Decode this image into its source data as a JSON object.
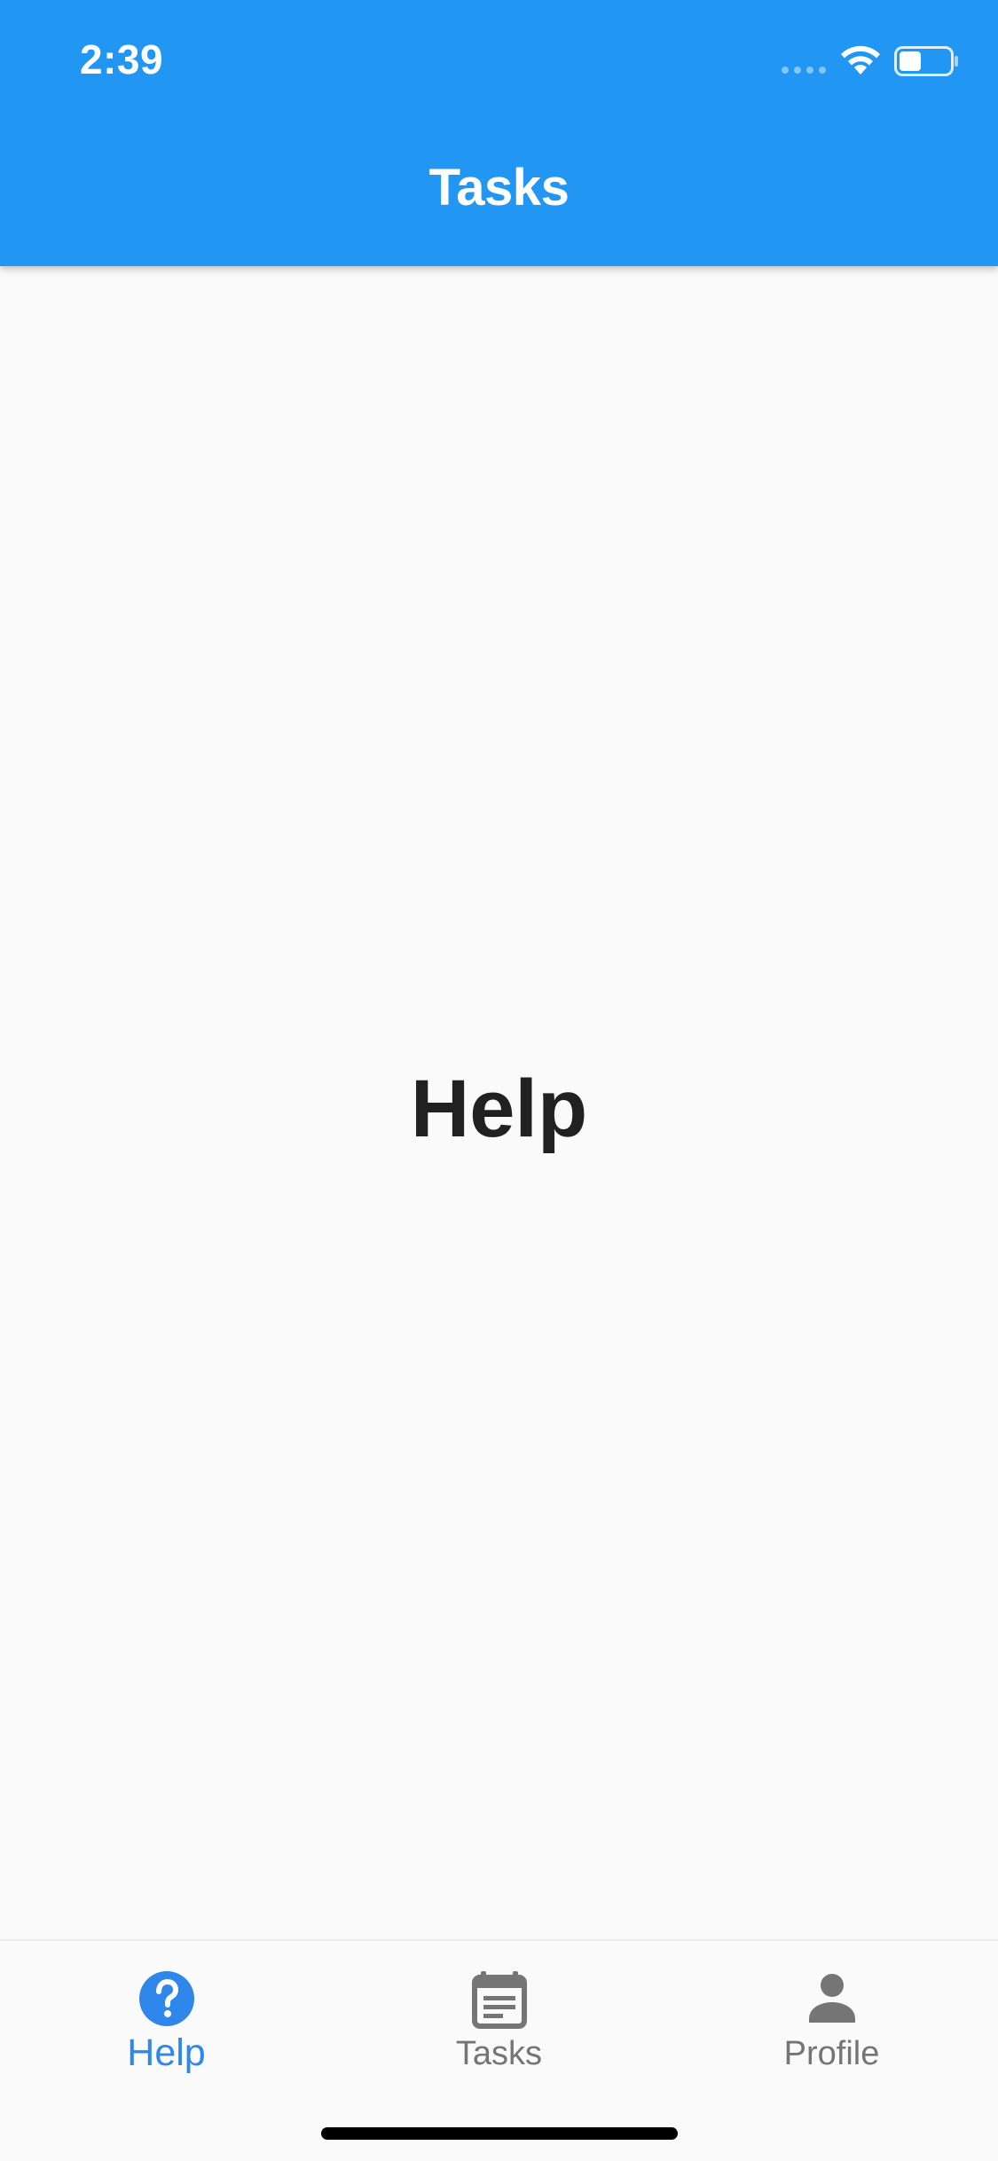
{
  "status_bar": {
    "time": "2:39"
  },
  "app_bar": {
    "title": "Tasks",
    "background_color": "#2196f3"
  },
  "main": {
    "center_text": "Help"
  },
  "bottom_nav": {
    "active_color": "#2f86eb",
    "inactive_color": "#757575",
    "items": [
      {
        "label": "Help",
        "icon": "help-circle-icon",
        "active": true
      },
      {
        "label": "Tasks",
        "icon": "event-note-icon",
        "active": false
      },
      {
        "label": "Profile",
        "icon": "person-icon",
        "active": false
      }
    ]
  }
}
